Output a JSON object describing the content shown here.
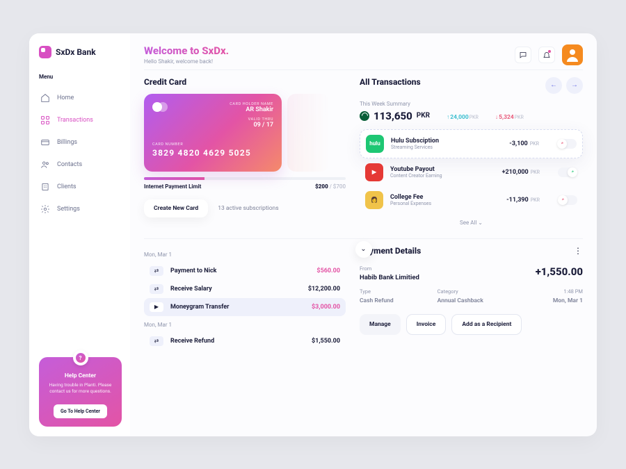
{
  "brand": "SxDx Bank",
  "sidebar": {
    "menu_label": "Menu",
    "items": [
      {
        "label": "Home"
      },
      {
        "label": "Transactions"
      },
      {
        "label": "Billings"
      },
      {
        "label": "Contacts"
      },
      {
        "label": "Clients"
      },
      {
        "label": "Settings"
      }
    ],
    "help": {
      "title": "Help Center",
      "text": "Having trouble in Planti. Please contact us for more questions.",
      "button": "Go To Help Center",
      "q": "?"
    }
  },
  "header": {
    "title": "Welcome to SxDx.",
    "subtitle": "Hello Shakir, welcome back!"
  },
  "credit_card": {
    "section_title": "Credit Card",
    "holder_label": "CARD HOLDER NAME",
    "holder": "AR Shakir",
    "valid_label": "VALID THRU",
    "valid": "09 / 17",
    "number_label": "CARD NUMBER",
    "number": "3829 4820 4629 5025",
    "limit_label": "Internet Payment Limit",
    "limit_used": "$200",
    "limit_total": " / $700",
    "create_btn": "Create New Card",
    "active_subs": "13 active subscriptions"
  },
  "transactions": {
    "section_title": "All Transactions",
    "summary_label": "This Week Summary",
    "total": "113,650",
    "currency": "PKR",
    "up": "24,000",
    "down": "5,324",
    "items": [
      {
        "name": "Hulu Subsciption",
        "sub": "Streaming Services",
        "amount": "-3,100",
        "currency": "PKR",
        "color": "#1ec773",
        "tag": "hulu"
      },
      {
        "name": "Youtube Payout",
        "sub": "Content Creator Earning",
        "amount": "+210,000",
        "currency": "PKR",
        "color": "#e53935",
        "tag": "▶"
      },
      {
        "name": "College Fee",
        "sub": "Personal Expenses",
        "amount": "-11,390",
        "currency": "PKR",
        "color": "#f0c34a",
        "tag": "👩"
      }
    ],
    "see_all": "See All  ⌄"
  },
  "payments": {
    "date1": "Mon, Mar 1",
    "date2": "Mon, Mar 1",
    "rows": [
      {
        "name": "Payment to Nick",
        "amount": "$560.00",
        "pink": true,
        "icon": "⇄"
      },
      {
        "name": "Receive Salary",
        "amount": "$12,200.00",
        "pink": false,
        "icon": "⇄"
      },
      {
        "name": "Moneygram Transfer",
        "amount": "$3,000.00",
        "pink": true,
        "icon": "▶"
      },
      {
        "name": "Receive Refund",
        "amount": "$1,550.00",
        "pink": false,
        "icon": "⇄"
      }
    ]
  },
  "details": {
    "title": "Payment Details",
    "from_label": "From",
    "from": "Habib Bank Limitied",
    "amount": "+1,550.00",
    "type_label": "Type",
    "type": "Cash Refund",
    "category_label": "Category",
    "category": "Annual Cashback",
    "time": "1:48 PM",
    "date": "Mon, Mar 1",
    "manage": "Manage",
    "invoice": "Invoice",
    "recipient": "Add as a Recipient"
  }
}
